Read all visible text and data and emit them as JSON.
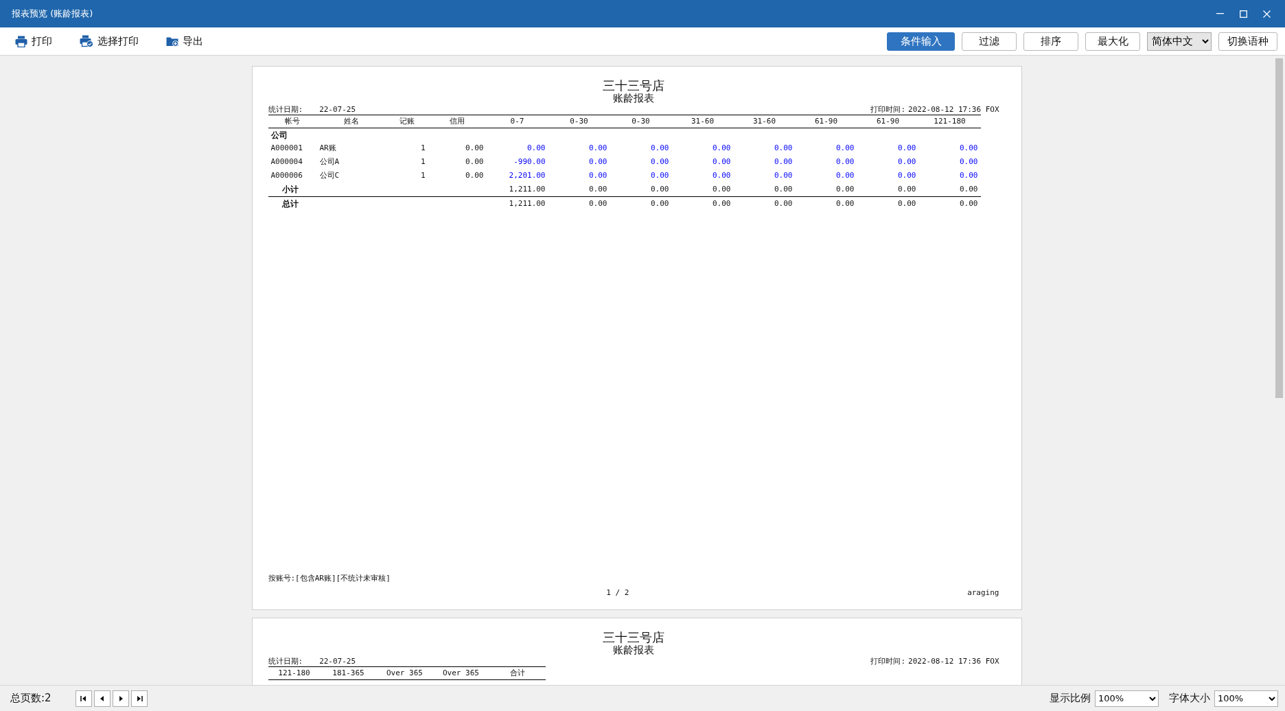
{
  "window": {
    "title": "报表预览 (账龄报表)"
  },
  "toolbar": {
    "left": [
      {
        "kind": "print",
        "label": "打印"
      },
      {
        "kind": "select-print",
        "label": "选择打印"
      },
      {
        "kind": "export",
        "label": "导出"
      }
    ],
    "right": [
      {
        "kind": "button",
        "label": "条件输入",
        "active": true
      },
      {
        "kind": "button",
        "label": "过滤",
        "active": false
      },
      {
        "kind": "button",
        "label": "排序",
        "active": false
      },
      {
        "kind": "button",
        "label": "最大化",
        "active": false
      },
      {
        "kind": "select",
        "value": "简体中文"
      },
      {
        "kind": "button",
        "label": "切换语种",
        "active": false
      }
    ]
  },
  "pages": [
    {
      "store": "三十三号店",
      "title": "账龄报表",
      "date_label": "统计日期:",
      "date": "22-07-25",
      "print_time_label": "打印时间:",
      "print_time": "2022-08-12 17:36 FOX",
      "columns": [
        "帐号",
        "姓名",
        "记账",
        "信用",
        "0-7",
        "0-30",
        "0-30",
        "31-60",
        "31-60",
        "61-90",
        "61-90",
        "121-180"
      ],
      "rows": [
        {
          "kind": "group",
          "label": "公司"
        },
        {
          "kind": "account",
          "cells": [
            "A000001",
            "AR账",
            "1",
            "0.00",
            "0.00",
            "0.00",
            "0.00",
            "0.00",
            "0.00",
            "0.00",
            "0.00",
            "0.00"
          ]
        },
        {
          "kind": "account",
          "cells": [
            "A000004",
            "公司A",
            "1",
            "0.00",
            "-990.00",
            "0.00",
            "0.00",
            "0.00",
            "0.00",
            "0.00",
            "0.00",
            "0.00"
          ]
        },
        {
          "kind": "account",
          "cells": [
            "A000006",
            "公司C",
            "1",
            "0.00",
            "2,201.00",
            "0.00",
            "0.00",
            "0.00",
            "0.00",
            "0.00",
            "0.00",
            "0.00"
          ]
        },
        {
          "kind": "subtotal",
          "label": "小计",
          "cells": [
            "1,211.00",
            "0.00",
            "0.00",
            "0.00",
            "0.00",
            "0.00",
            "0.00",
            "0.00"
          ]
        },
        {
          "kind": "total",
          "label": "总计",
          "cells": [
            "1,211.00",
            "0.00",
            "0.00",
            "0.00",
            "0.00",
            "0.00",
            "0.00",
            "0.00"
          ]
        }
      ],
      "footer_note": "按账号:[包含AR账][不统计未审核]",
      "page_number": "1 / 2",
      "report_code": "araging"
    },
    {
      "store": "三十三号店",
      "title": "账龄报表",
      "date_label": "统计日期:",
      "date": "22-07-25",
      "print_time_label": "打印时间:",
      "print_time": "2022-08-12 17:36 FOX",
      "columns": [
        "121-180",
        "181-365",
        "Over 365",
        "Over 365",
        "合计"
      ]
    }
  ],
  "status_bar": {
    "page_count": "总页数:2",
    "zoom_label": "显示比例",
    "zoom": "100%",
    "font_size_label": "字体大小",
    "font_size": "100%"
  }
}
